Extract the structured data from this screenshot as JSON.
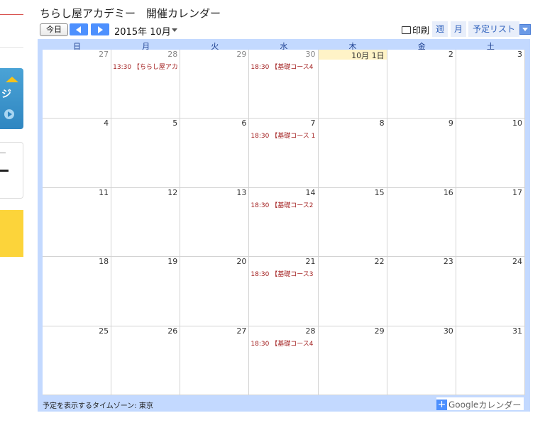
{
  "sidebar": {
    "blue_banner_text": "ジ"
  },
  "calendar": {
    "title": "ちらし屋アカデミー　開催カレンダー",
    "toolbar": {
      "today_label": "今日",
      "month_label": "2015年 10月",
      "print_label": "印刷",
      "tabs": {
        "week": "週",
        "month": "月",
        "agenda": "予定リスト"
      }
    },
    "day_names": [
      "日",
      "月",
      "火",
      "水",
      "木",
      "金",
      "土"
    ],
    "weeks": [
      [
        {
          "num": "27",
          "other": true,
          "event": ""
        },
        {
          "num": "28",
          "other": true,
          "event": "13:30 【ちらし屋アカ"
        },
        {
          "num": "29",
          "other": true,
          "event": ""
        },
        {
          "num": "30",
          "other": true,
          "event": "18:30 【基礎コース4"
        },
        {
          "num": "10月 1日",
          "today": true,
          "event": ""
        },
        {
          "num": "2",
          "event": ""
        },
        {
          "num": "3",
          "event": ""
        }
      ],
      [
        {
          "num": "4",
          "event": ""
        },
        {
          "num": "5",
          "event": ""
        },
        {
          "num": "6",
          "event": ""
        },
        {
          "num": "7",
          "event": "18:30 【基礎コース 1"
        },
        {
          "num": "8",
          "event": ""
        },
        {
          "num": "9",
          "event": ""
        },
        {
          "num": "10",
          "event": ""
        }
      ],
      [
        {
          "num": "11",
          "event": ""
        },
        {
          "num": "12",
          "event": ""
        },
        {
          "num": "13",
          "event": ""
        },
        {
          "num": "14",
          "event": "18:30 【基礎コース2"
        },
        {
          "num": "15",
          "event": ""
        },
        {
          "num": "16",
          "event": ""
        },
        {
          "num": "17",
          "event": ""
        }
      ],
      [
        {
          "num": "18",
          "event": ""
        },
        {
          "num": "19",
          "event": ""
        },
        {
          "num": "20",
          "event": ""
        },
        {
          "num": "21",
          "event": "18:30 【基礎コース3"
        },
        {
          "num": "22",
          "event": ""
        },
        {
          "num": "23",
          "event": ""
        },
        {
          "num": "24",
          "event": ""
        }
      ],
      [
        {
          "num": "25",
          "event": ""
        },
        {
          "num": "26",
          "event": ""
        },
        {
          "num": "27",
          "event": ""
        },
        {
          "num": "28",
          "event": "18:30 【基礎コース4"
        },
        {
          "num": "29",
          "event": ""
        },
        {
          "num": "30",
          "event": ""
        },
        {
          "num": "31",
          "event": ""
        }
      ]
    ],
    "footer": {
      "timezone_text": "予定を表示するタイムゾーン: 東京",
      "google_label": "Google",
      "calendar_label": "カレンダー"
    }
  }
}
